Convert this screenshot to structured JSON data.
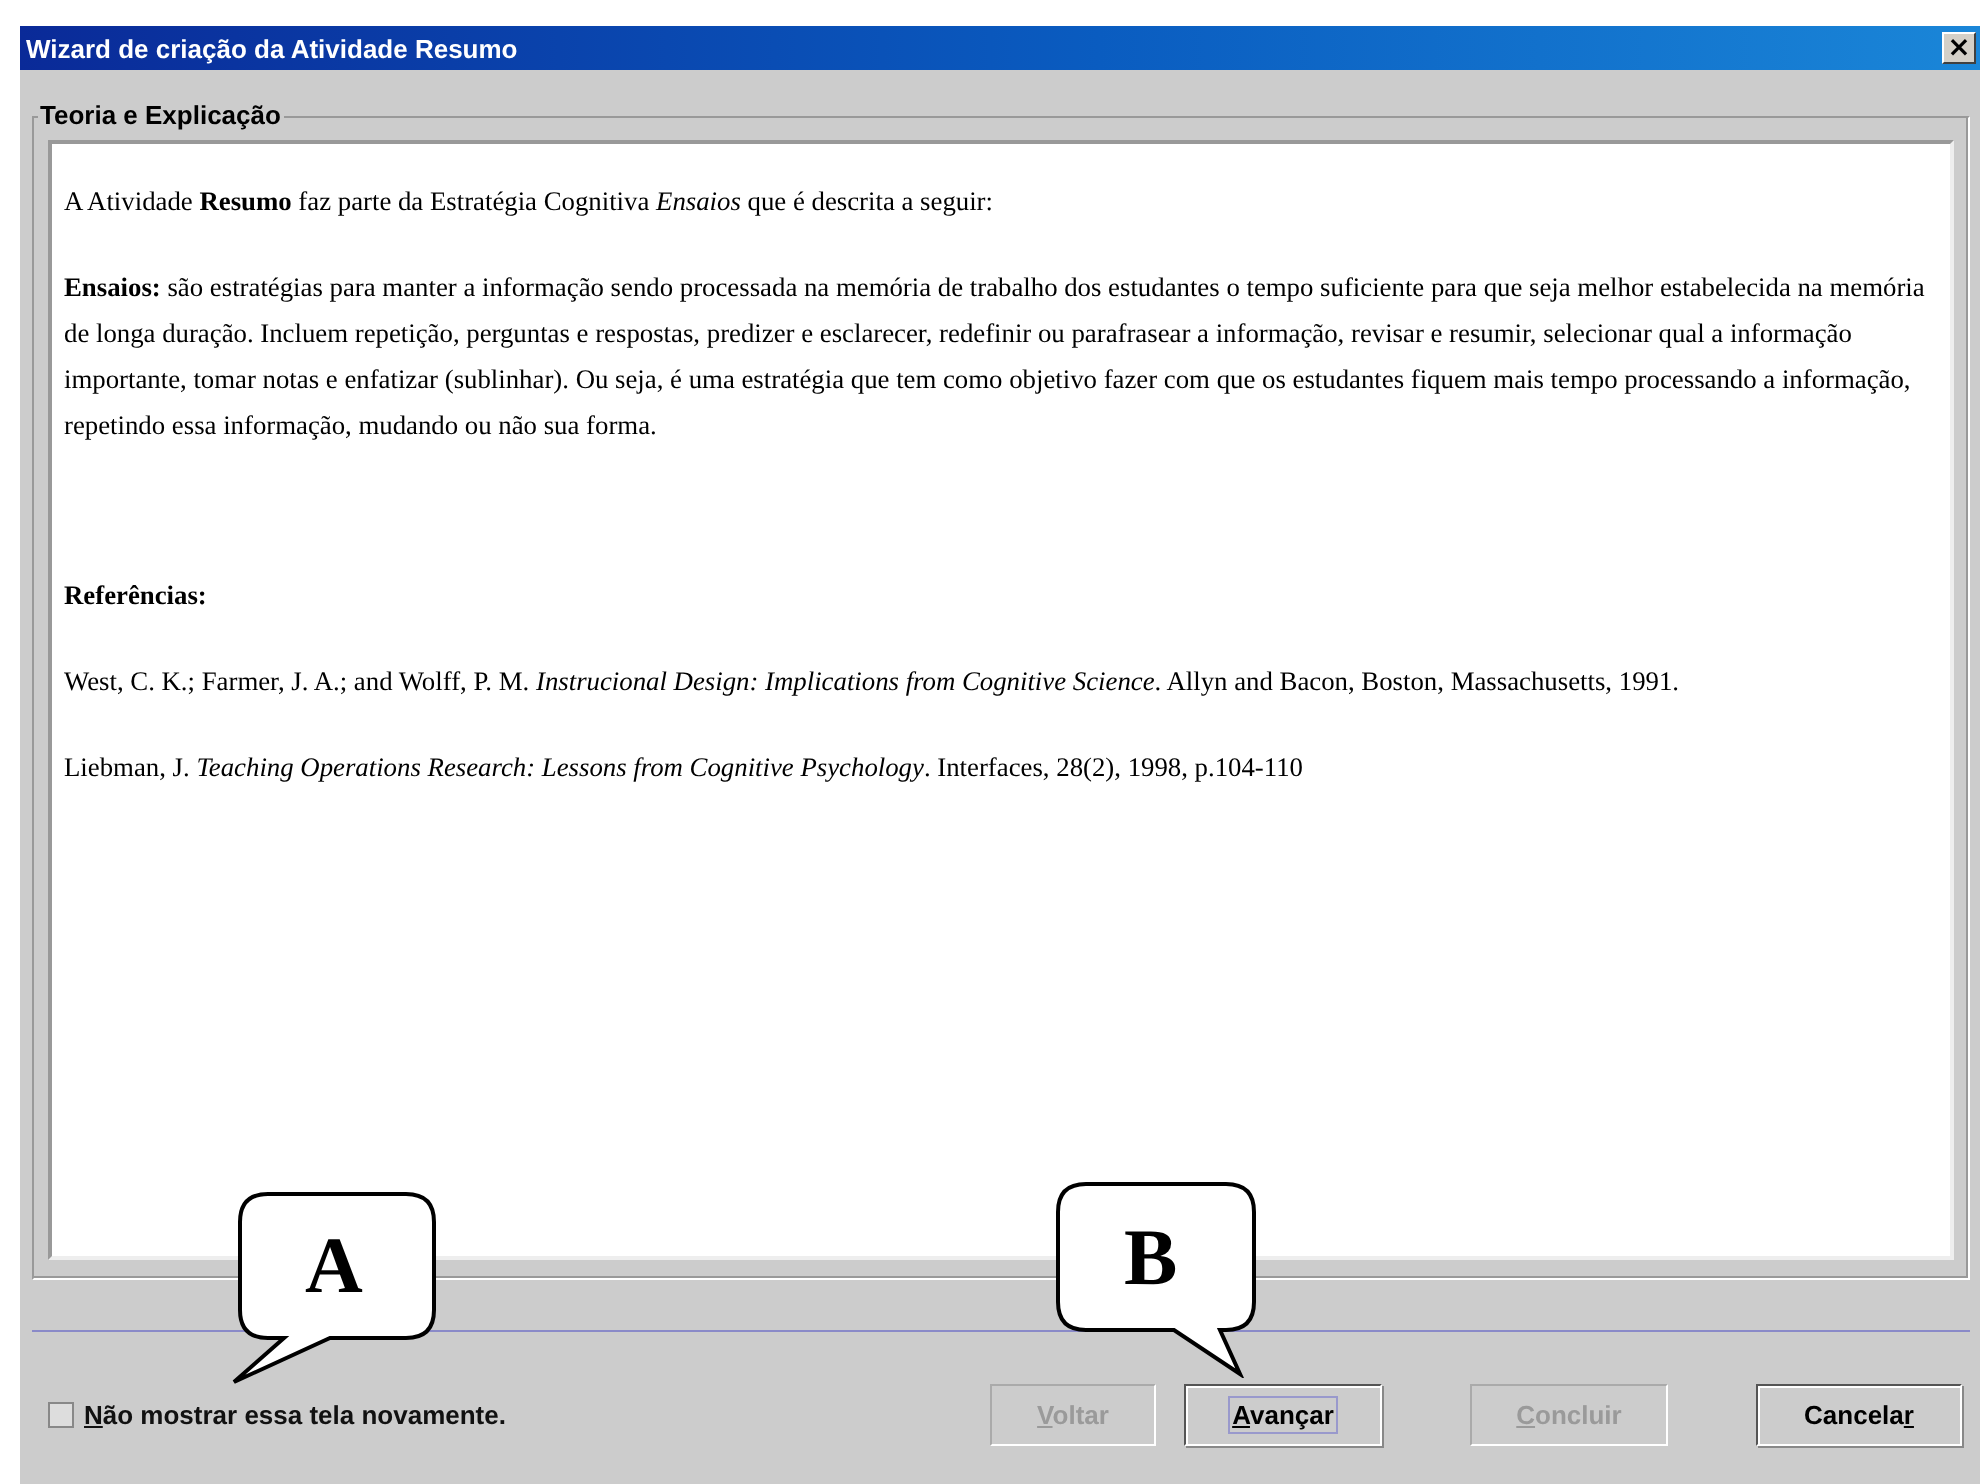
{
  "window": {
    "title": "Wizard de criação da Atividade Resumo",
    "close_glyph": "×"
  },
  "group": {
    "title": "Teoria e Explicação"
  },
  "content": [
    {
      "kind": "paragraph",
      "text": "A Atividade **Resumo** faz parte da Estratégia Cognitiva *Ensaios* que é descrita a seguir:"
    },
    {
      "kind": "paragraph",
      "text": "**Ensaios:** são estratégias para manter a informação sendo processada na memória de trabalho dos estudantes o tempo suficiente para que seja melhor estabelecida na memória de longa duração. Incluem repetição, perguntas e respostas, predizer e esclarecer, redefinir ou parafrasear a informação, revisar e resumir, selecionar qual a informação importante, tomar notas e enfatizar (sublinhar). Ou seja, é uma estratégia que tem como objetivo fazer com que os estudantes fiquem mais tempo processando a informação, repetindo essa informação, mudando ou não sua forma."
    },
    {
      "kind": "heading",
      "text": "Referências:"
    },
    {
      "kind": "paragraph",
      "text": "West, C. K.; Farmer, J. A.; and Wolff, P. M. *Instrucional Design: Implications from Cognitive Science*. Allyn and Bacon, Boston, Massachusetts, 1991."
    },
    {
      "kind": "paragraph",
      "text": "Liebman, J. *Teaching Operations Research: Lessons from Cognitive Psychology*. Interfaces, 28(2), 1998, p.104-110"
    }
  ],
  "checkbox": {
    "key": "N",
    "after": "ão mostrar essa tela novamente.",
    "checked": false
  },
  "buttons": [
    {
      "key": "V",
      "after": "oltar",
      "disabled": true,
      "focused": false
    },
    {
      "key": "A",
      "after": "vançar",
      "disabled": false,
      "focused": true
    },
    {
      "key": "C",
      "after": "oncluir",
      "disabled": true,
      "focused": false
    },
    {
      "before": "Cancela",
      "key": "r",
      "disabled": false,
      "focused": false
    }
  ],
  "callouts": [
    {
      "letter": "A"
    },
    {
      "letter": "B"
    }
  ]
}
